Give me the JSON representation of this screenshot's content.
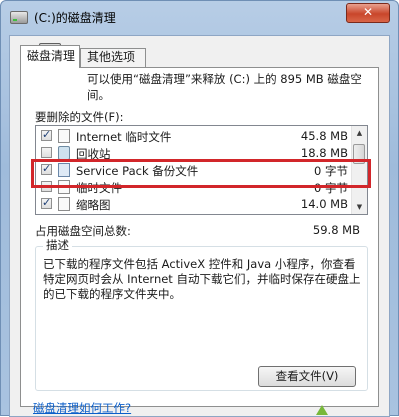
{
  "window": {
    "title": "(C:)的磁盘清理",
    "close_label": "✕"
  },
  "tabs": [
    {
      "label": "磁盘清理",
      "active": true
    },
    {
      "label": "其他选项",
      "active": false
    }
  ],
  "intro": {
    "text": "可以使用“磁盘清理”来释放 (C:) 上的 895 MB 磁盘空间。",
    "icon": "drive-icon"
  },
  "files_label": "要删除的文件(F):",
  "files": [
    {
      "name": "Internet 临时文件",
      "size": "45.8 MB",
      "checked": true,
      "icon": "file-icon"
    },
    {
      "name": "回收站",
      "size": "18.8 MB",
      "checked": false,
      "icon": "recycle-bin-icon"
    },
    {
      "name": "Service Pack 备份文件",
      "size": "0 字节",
      "checked": true,
      "icon": "package-icon"
    },
    {
      "name": "临时文件",
      "size": "0 字节",
      "checked": false,
      "icon": "file-icon"
    },
    {
      "name": "缩略图",
      "size": "14.0 MB",
      "checked": true,
      "icon": "file-icon"
    }
  ],
  "total": {
    "label": "占用磁盘空间总数:",
    "value": "59.8 MB"
  },
  "description": {
    "legend": "描述",
    "text": "已下载的程序文件包括 ActiveX 控件和 Java 小程序，你查看特定网页时会从 Internet 自动下载它们，并临时保存在硬盘上的已下载的程序文件夹中。"
  },
  "buttons": {
    "view_files": "查看文件(V)"
  },
  "help_link": "磁盘清理如何工作?",
  "colors": {
    "highlight": "#d2262a",
    "link": "#0b5ec9"
  }
}
